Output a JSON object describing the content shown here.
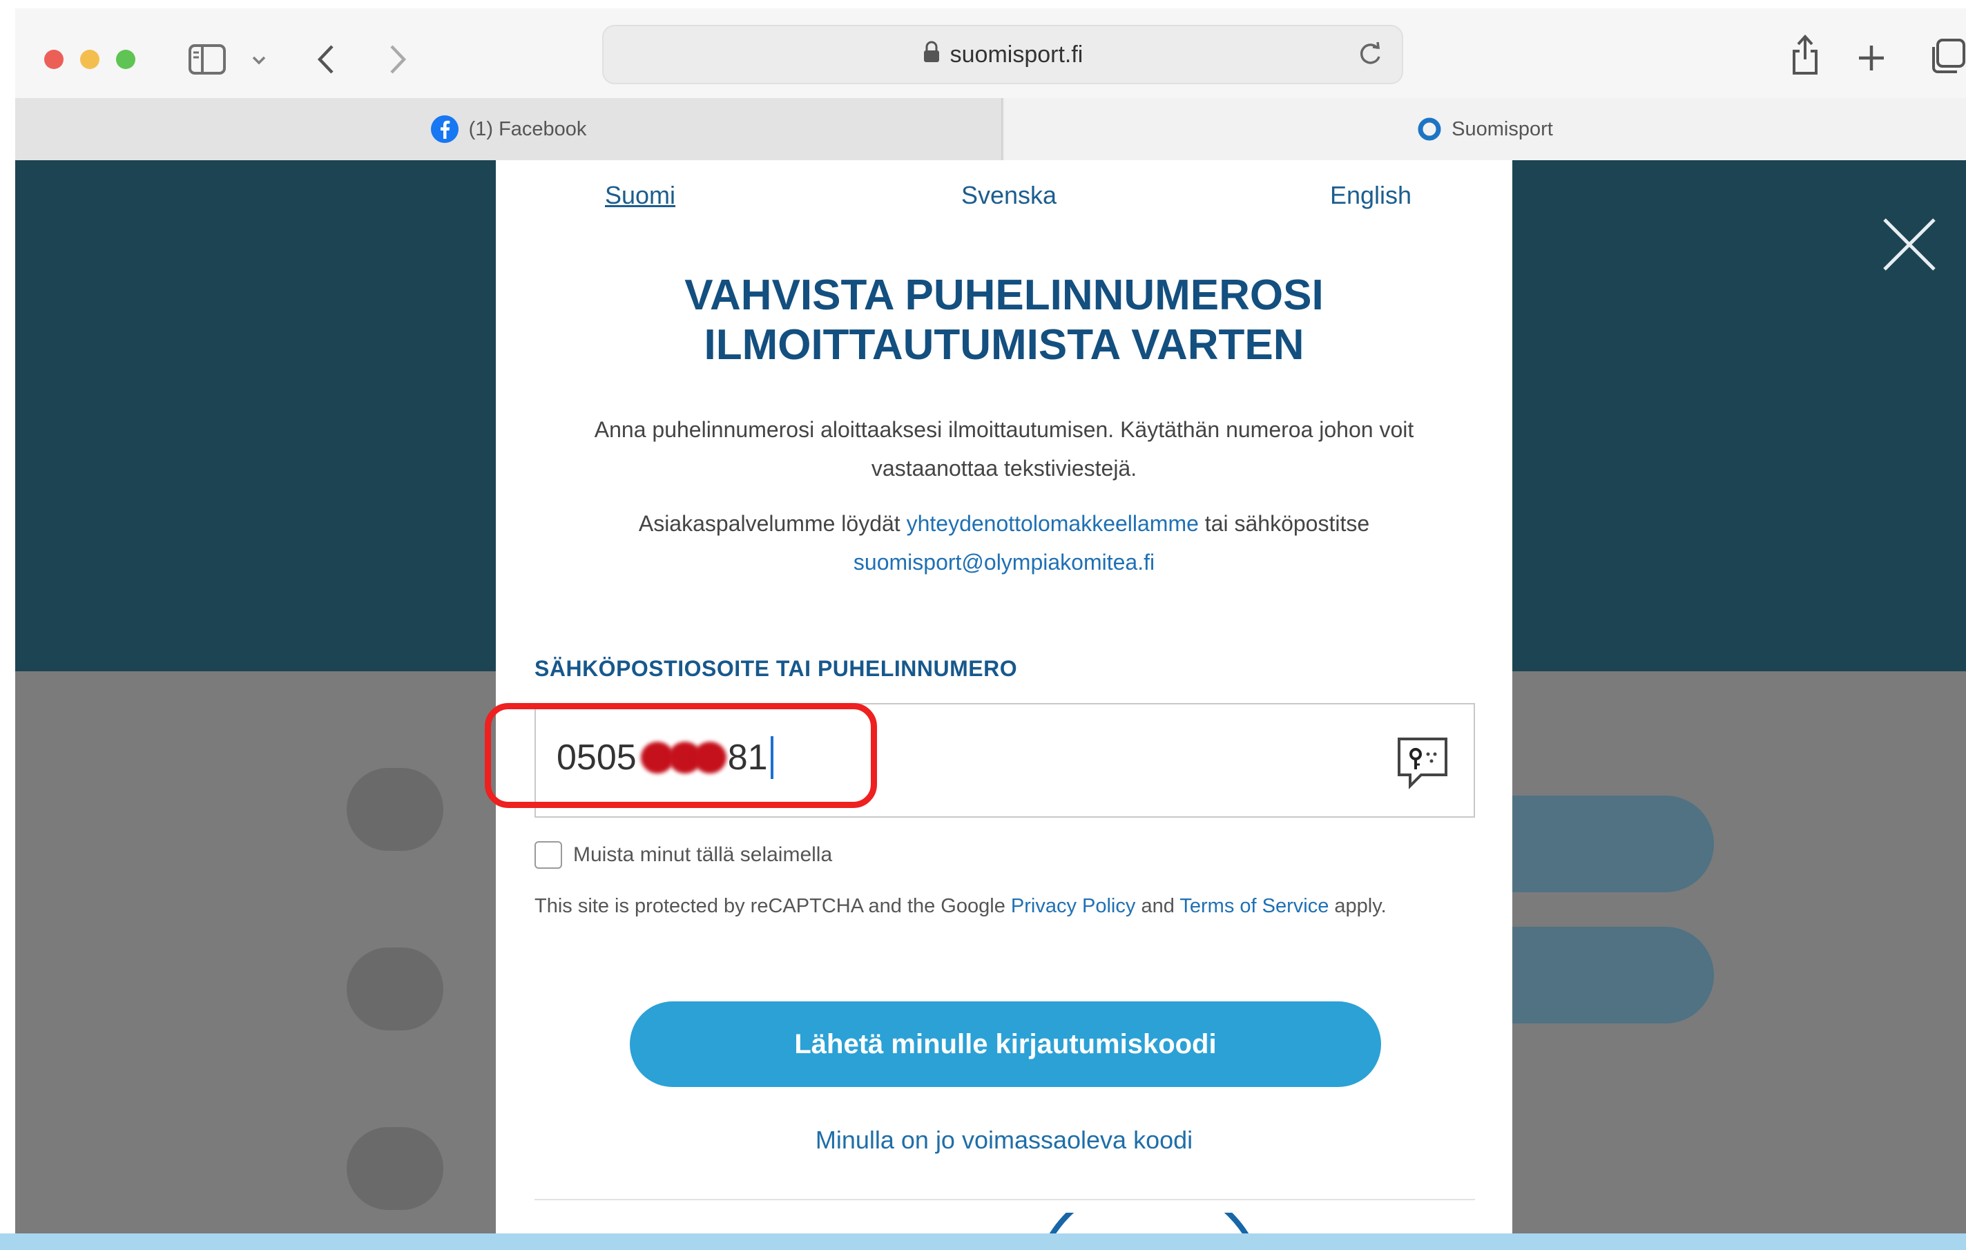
{
  "browser": {
    "url": "suomisport.fi",
    "tabs": [
      {
        "label": "(1) Facebook",
        "active": false
      },
      {
        "label": "Suomisport",
        "active": true
      }
    ]
  },
  "modal": {
    "languages": {
      "fi": "Suomi",
      "sv": "Svenska",
      "en": "English"
    },
    "title_line1": "VAHVISTA PUHELINNUMEROSI",
    "title_line2": "ILMOITTAUTUMISTA VARTEN",
    "intro": "Anna puhelinnumerosi aloittaaksesi ilmoittautumisen. Käytäthän numeroa johon voit vastaanottaa tekstiviestejä.",
    "support_prefix": "Asiakaspalvelumme löydät",
    "support_link": "yhteydenottolomakkeellamme",
    "support_middle": "tai sähköpostitse",
    "support_email": "suomisport@olympiakomitea.fi",
    "field_label": "SÄHKÖPOSTIOSOITE TAI PUHELINNUMERO",
    "input_value_start": "0505",
    "input_value_end": "81",
    "remember_label": "Muista minut tällä selaimella",
    "recaptcha_prefix": "This site is protected by reCAPTCHA and the Google",
    "privacy_link": "Privacy Policy",
    "recaptcha_and": "and",
    "terms_link": "Terms of Service",
    "recaptcha_suffix": "apply.",
    "submit_label": "Lähetä minulle kirjautumiskoodi",
    "have_code_link": "Minulla on jo voimassaoleva koodi"
  },
  "colors": {
    "title": "#134f7f",
    "link": "#1f70b4",
    "button": "#2ba1d6",
    "highlight": "#ee2020"
  }
}
